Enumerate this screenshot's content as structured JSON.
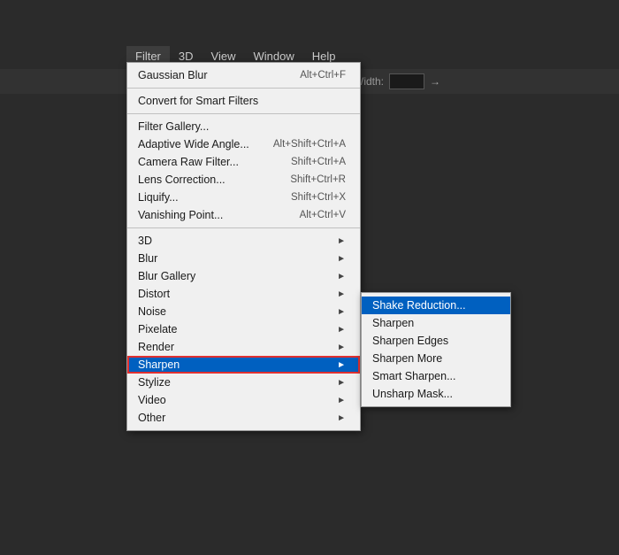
{
  "app": {
    "background": "#2b2b2b"
  },
  "menubar": {
    "items": [
      {
        "label": "Filter",
        "active": true
      },
      {
        "label": "3D"
      },
      {
        "label": "View"
      },
      {
        "label": "Window"
      },
      {
        "label": "Help"
      }
    ]
  },
  "toolbar": {
    "width_label": "Width:",
    "arrow_icon": "→"
  },
  "filter_menu": {
    "top_item": {
      "label": "Gaussian Blur",
      "shortcut": "Alt+Ctrl+F"
    },
    "separator1": true,
    "smart_filters": {
      "label": "Convert for Smart Filters"
    },
    "separator2": true,
    "items": [
      {
        "label": "Filter Gallery...",
        "shortcut": ""
      },
      {
        "label": "Adaptive Wide Angle...",
        "shortcut": "Alt+Shift+Ctrl+A"
      },
      {
        "label": "Camera Raw Filter...",
        "shortcut": "Shift+Ctrl+A"
      },
      {
        "label": "Lens Correction...",
        "shortcut": "Shift+Ctrl+R"
      },
      {
        "label": "Liquify...",
        "shortcut": "Shift+Ctrl+X"
      },
      {
        "label": "Vanishing Point...",
        "shortcut": "Alt+Ctrl+V"
      }
    ],
    "separator3": true,
    "submenus": [
      {
        "label": "3D",
        "has_arrow": true
      },
      {
        "label": "Blur",
        "has_arrow": true
      },
      {
        "label": "Blur Gallery",
        "has_arrow": true
      },
      {
        "label": "Distort",
        "has_arrow": true
      },
      {
        "label": "Noise",
        "has_arrow": true
      },
      {
        "label": "Pixelate",
        "has_arrow": true
      },
      {
        "label": "Render",
        "has_arrow": true
      },
      {
        "label": "Sharpen",
        "has_arrow": true,
        "highlighted": true
      },
      {
        "label": "Stylize",
        "has_arrow": true
      },
      {
        "label": "Video",
        "has_arrow": true
      },
      {
        "label": "Other",
        "has_arrow": true
      }
    ]
  },
  "sharpen_submenu": {
    "items": [
      {
        "label": "Shake Reduction...",
        "highlighted": true
      },
      {
        "label": "Sharpen"
      },
      {
        "label": "Sharpen Edges"
      },
      {
        "label": "Sharpen More"
      },
      {
        "label": "Smart Sharpen..."
      },
      {
        "label": "Unsharp Mask..."
      }
    ]
  }
}
